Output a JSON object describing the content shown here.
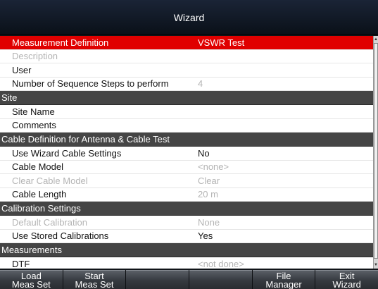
{
  "window": {
    "title": "Wizard"
  },
  "grid": {
    "rows": [
      {
        "kind": "row",
        "label": "Measurement Definition",
        "value": "VSWR Test",
        "state": "selected"
      },
      {
        "kind": "row",
        "label": "Description",
        "value": "",
        "state": "disabled"
      },
      {
        "kind": "row",
        "label": "User",
        "value": "",
        "state": "normal"
      },
      {
        "kind": "row",
        "label": "Number of Sequence Steps to perform",
        "value": "4",
        "state": "value-dim"
      },
      {
        "kind": "section",
        "label": "Site"
      },
      {
        "kind": "row",
        "label": "Site Name",
        "value": "",
        "state": "normal"
      },
      {
        "kind": "row",
        "label": "Comments",
        "value": "",
        "state": "normal"
      },
      {
        "kind": "section",
        "label": "Cable Definition for Antenna & Cable Test"
      },
      {
        "kind": "row",
        "label": "Use Wizard Cable Settings",
        "value": "No",
        "state": "normal"
      },
      {
        "kind": "row",
        "label": "Cable Model",
        "value": "<none>",
        "state": "value-dim"
      },
      {
        "kind": "row",
        "label": "Clear Cable Model",
        "value": "Clear",
        "state": "disabled"
      },
      {
        "kind": "row",
        "label": "Cable Length",
        "value": "20 m",
        "state": "value-dim"
      },
      {
        "kind": "section",
        "label": "Calibration Settings"
      },
      {
        "kind": "row",
        "label": "Default Calibration",
        "value": "None",
        "state": "disabled"
      },
      {
        "kind": "row",
        "label": "Use Stored Calibrations",
        "value": "Yes",
        "state": "normal"
      },
      {
        "kind": "section",
        "label": "Measurements"
      },
      {
        "kind": "row",
        "label": "DTF",
        "value": "<not done>",
        "state": "value-dim"
      }
    ]
  },
  "softkeys": [
    {
      "line1": "Load",
      "line2": "Meas Set"
    },
    {
      "line1": "Start",
      "line2": "Meas Set"
    },
    {
      "line1": "",
      "line2": ""
    },
    {
      "line1": "",
      "line2": ""
    },
    {
      "line1": "File",
      "line2": "Manager"
    },
    {
      "line1": "Exit",
      "line2": "Wizard"
    }
  ],
  "colors": {
    "selected_row": "#e00000",
    "section_header": "#454545",
    "title_bar": "#0a1018",
    "disabled_text": "#b4b4b4"
  }
}
